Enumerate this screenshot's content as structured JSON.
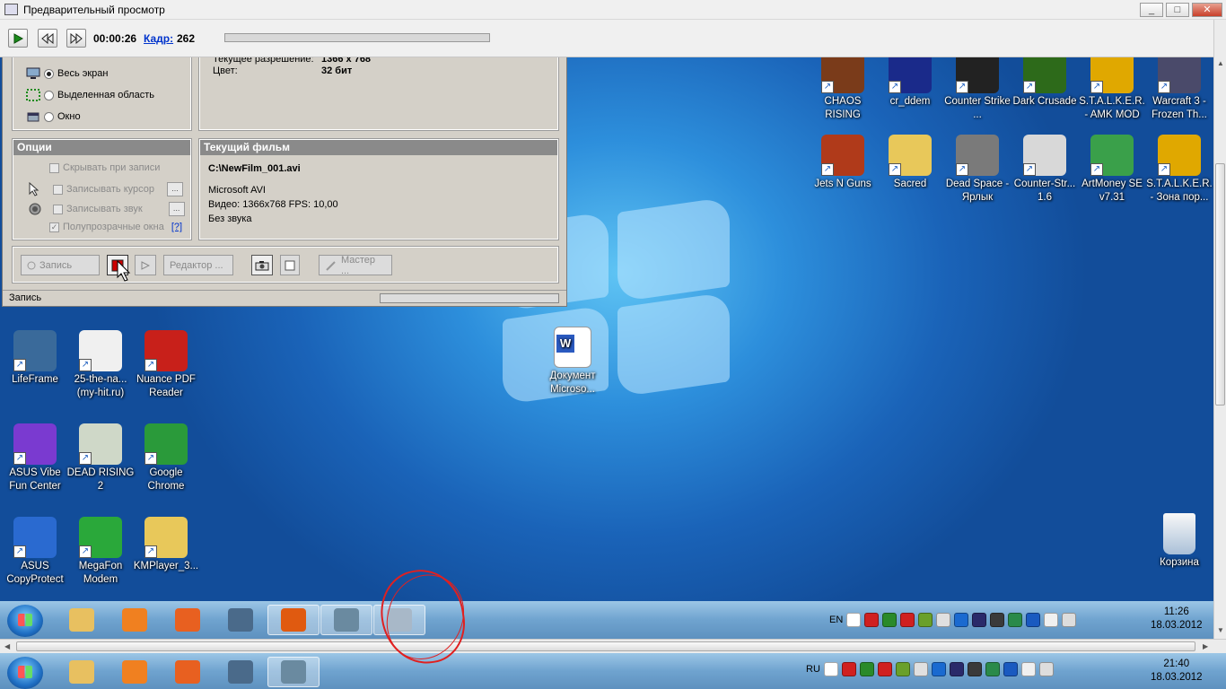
{
  "window": {
    "title": "Предварительный просмотр",
    "min": "_",
    "max": "□",
    "close": "✕"
  },
  "toolbar": {
    "time": "00:00:26",
    "frame_label": "Кадр:",
    "frame_value": "262"
  },
  "capture": {
    "area_options": [
      {
        "label": "Весь экран",
        "selected": true
      },
      {
        "label": "Выделенная область",
        "selected": false
      },
      {
        "label": "Окно",
        "selected": false
      }
    ],
    "screen_info": {
      "res_label": "Текущее разрешение:",
      "res_value": "1366 x 768",
      "color_label": "Цвет:",
      "color_value": "32 бит"
    },
    "options_header": "Опции",
    "options": [
      {
        "label": "Скрывать при записи",
        "checked": false,
        "has_button": false
      },
      {
        "label": "Записывать курсор",
        "checked": false,
        "has_button": true
      },
      {
        "label": "Записывать звук",
        "checked": false,
        "has_button": true
      },
      {
        "label": "Полупрозрачные окна",
        "checked": true,
        "has_button": false,
        "help": "[?]"
      }
    ],
    "film_header": "Текущий фильм",
    "film": {
      "path": "C:\\NewFilm_001.avi",
      "format": "Microsoft AVI",
      "video": "Видео: 1366x768   FPS: 10,00",
      "audio": "Без звука"
    },
    "buttons": {
      "record": "Запись",
      "editor": "Редактор ...",
      "wizard": "Мастер ..."
    },
    "status": "Запись",
    "more_button": "..."
  },
  "desktop_icons_right": [
    {
      "label": "CHAOS RISING",
      "color": "#7a3b1a"
    },
    {
      "label": "cr_ddem",
      "color": "#1a2a8a"
    },
    {
      "label": "Counter Strike ...",
      "color": "#222222"
    },
    {
      "label": "Dark Crusade",
      "color": "#2d6a1a"
    },
    {
      "label": "S.T.A.L.K.E.R. - AMK MOD",
      "color": "#e0a800"
    },
    {
      "label": "Warcraft 3 - Frozen Th...",
      "color": "#4a4a6a"
    },
    {
      "label": "Jets N Guns",
      "color": "#b03a1a"
    },
    {
      "label": "Sacred",
      "color": "#e8c85a"
    },
    {
      "label": "Dead Space - Ярлык",
      "color": "#7a7a7a"
    },
    {
      "label": "Counter-Str... 1.6",
      "color": "#d8d8d8"
    },
    {
      "label": "ArtMoney SE v7.31",
      "color": "#3aa04a"
    },
    {
      "label": "S.T.A.L.K.E.R. - Зона пор...",
      "color": "#e0a800"
    }
  ],
  "desktop_icons_left": [
    {
      "label": "LifeFrame",
      "color": "#3a6a9a"
    },
    {
      "label": "25-the-na... (my-hit.ru)",
      "color": "#f0f0f0"
    },
    {
      "label": "Nuance PDF Reader",
      "color": "#c8201a"
    },
    {
      "label": "ASUS Vibe Fun Center",
      "color": "#7a3ad0"
    },
    {
      "label": "DEAD RISING 2",
      "color": "#cfd8c8"
    },
    {
      "label": "Google Chrome",
      "color": "#2a9a3a"
    },
    {
      "label": "ASUS CopyProtect",
      "color": "#2a6ad0"
    },
    {
      "label": "MegaFon Modem",
      "color": "#2aa83a"
    },
    {
      "label": "KMPlayer_3...",
      "color": "#e8c85a"
    }
  ],
  "desktop_doc": {
    "label": "Документ Microso...",
    "color": "#2a5ac0"
  },
  "recycle_bin": {
    "label": "Корзина",
    "color": "#c8d8e8"
  },
  "taskbar_inner": {
    "lang": "EN",
    "time": "11:26",
    "date": "18.03.2012"
  },
  "taskbar_outer": {
    "lang": "RU",
    "time": "21:40",
    "date": "18.03.2012"
  },
  "taskbar_apps_inner": [
    {
      "name": "explorer",
      "color": "#e8c060",
      "active": false
    },
    {
      "name": "media-player",
      "color": "#f08020",
      "active": false
    },
    {
      "name": "installer",
      "color": "#e86020",
      "active": false
    },
    {
      "name": "lifeframe",
      "color": "#4a6a8a",
      "active": false
    },
    {
      "name": "firefox",
      "color": "#e05a10",
      "active": true
    },
    {
      "name": "capture-tool",
      "color": "#6a8aa0",
      "active": true
    },
    {
      "name": "capture-preview",
      "color": "#a8b8c8",
      "active": true
    }
  ],
  "taskbar_apps_outer": [
    {
      "name": "explorer",
      "color": "#e8c060",
      "active": false
    },
    {
      "name": "media-player",
      "color": "#f08020",
      "active": false
    },
    {
      "name": "installer",
      "color": "#e86020",
      "active": false
    },
    {
      "name": "lifeframe",
      "color": "#4a6a8a",
      "active": false
    },
    {
      "name": "capture-tool",
      "color": "#6a8aa0",
      "active": true
    }
  ],
  "tray_icon_colors": [
    "#ffffff",
    "#d02020",
    "#2a8a2a",
    "#d02020",
    "#6aa02a",
    "#e0e0e0",
    "#1a6ad0",
    "#2a2a6a",
    "#3a3a3a",
    "#2a8a4a",
    "#1a5ac0",
    "#f0f0f0",
    "#dddddd"
  ]
}
